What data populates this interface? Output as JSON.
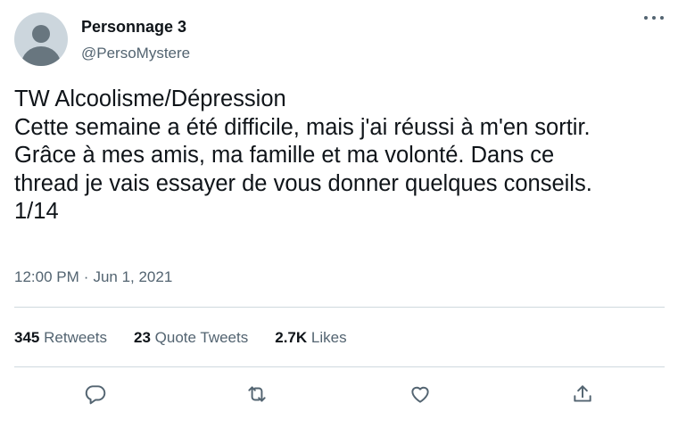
{
  "author": {
    "name": "Personnage 3",
    "handle": "@PersoMystere"
  },
  "tweet": {
    "lines": [
      "TW Alcoolisme/Dépression",
      "Cette semaine a été difficile, mais j'ai réussi à m'en sortir.",
      "Grâce à mes amis, ma famille et ma volonté. Dans ce",
      "thread je vais essayer de vous donner quelques conseils.",
      "1/14"
    ],
    "time": "12:00 PM",
    "separator": "·",
    "date": "Jun 1, 2021"
  },
  "stats": {
    "retweets": {
      "count": "345",
      "label": "Retweets"
    },
    "quotes": {
      "count": "23",
      "label": "Quote Tweets"
    },
    "likes": {
      "count": "2.7K",
      "label": "Likes"
    }
  },
  "icons": {
    "more": "more-dots-icon",
    "reply": "reply-bubble-icon",
    "retweet": "retweet-icon",
    "like": "heart-icon",
    "share": "share-icon"
  },
  "colors": {
    "text": "#0f1419",
    "secondary": "#536471",
    "divider": "#cfd9de",
    "avatar_bg": "#ccd6dd"
  }
}
